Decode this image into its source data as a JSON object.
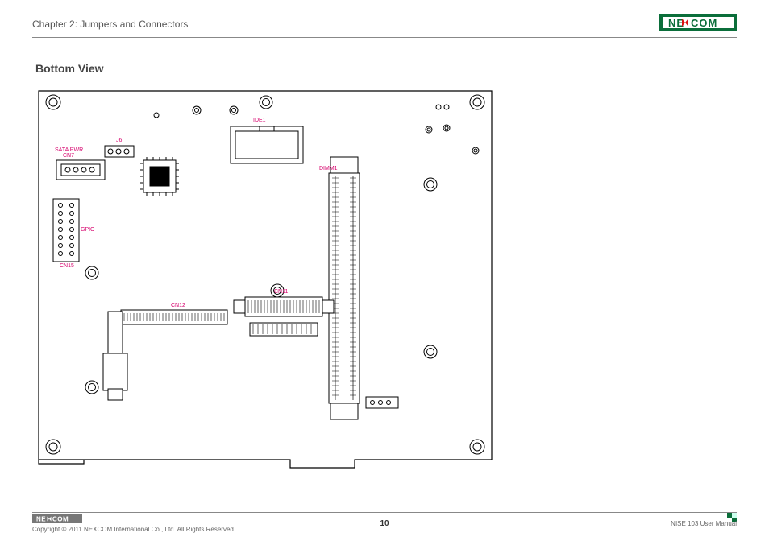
{
  "header": {
    "chapter": "Chapter 2: Jumpers and Connectors"
  },
  "brand": {
    "name_part1": "NE",
    "name_part2": "COM"
  },
  "title": "Bottom View",
  "connectors": {
    "ide1": "IDE1",
    "j6": "J6",
    "sata_pwr": "SATA PWR",
    "cn7": "CN7",
    "dimm1": "DIMM1",
    "gpio": "GPIO",
    "cn15": "CN15",
    "cn11": "CN11",
    "cn12": "CN12"
  },
  "footer": {
    "copyright": "Copyright © 2011 NEXCOM International Co., Ltd. All Rights Reserved.",
    "page": "10",
    "manual": "NISE 103 User Manual"
  }
}
